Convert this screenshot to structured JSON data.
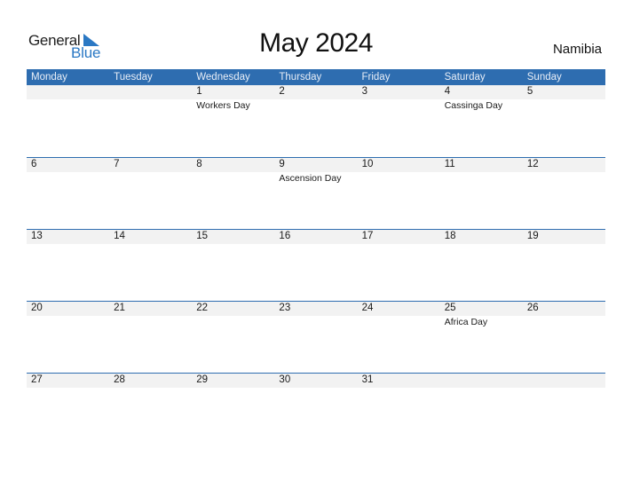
{
  "logo": {
    "word1": "General",
    "word2": "Blue",
    "icon": "triangle-flag-icon"
  },
  "title": "May 2024",
  "country": "Namibia",
  "colors": {
    "accent": "#2e6db0",
    "date_strip": "#f2f2f2",
    "logo_blue": "#2a78c4"
  },
  "weekdays": [
    "Monday",
    "Tuesday",
    "Wednesday",
    "Thursday",
    "Friday",
    "Saturday",
    "Sunday"
  ],
  "weeks": [
    {
      "days": [
        {
          "num": "",
          "holiday": ""
        },
        {
          "num": "",
          "holiday": ""
        },
        {
          "num": "1",
          "holiday": "Workers Day"
        },
        {
          "num": "2",
          "holiday": ""
        },
        {
          "num": "3",
          "holiday": ""
        },
        {
          "num": "4",
          "holiday": "Cassinga Day"
        },
        {
          "num": "5",
          "holiday": ""
        }
      ]
    },
    {
      "days": [
        {
          "num": "6",
          "holiday": ""
        },
        {
          "num": "7",
          "holiday": ""
        },
        {
          "num": "8",
          "holiday": ""
        },
        {
          "num": "9",
          "holiday": "Ascension Day"
        },
        {
          "num": "10",
          "holiday": ""
        },
        {
          "num": "11",
          "holiday": ""
        },
        {
          "num": "12",
          "holiday": ""
        }
      ]
    },
    {
      "days": [
        {
          "num": "13",
          "holiday": ""
        },
        {
          "num": "14",
          "holiday": ""
        },
        {
          "num": "15",
          "holiday": ""
        },
        {
          "num": "16",
          "holiday": ""
        },
        {
          "num": "17",
          "holiday": ""
        },
        {
          "num": "18",
          "holiday": ""
        },
        {
          "num": "19",
          "holiday": ""
        }
      ]
    },
    {
      "days": [
        {
          "num": "20",
          "holiday": ""
        },
        {
          "num": "21",
          "holiday": ""
        },
        {
          "num": "22",
          "holiday": ""
        },
        {
          "num": "23",
          "holiday": ""
        },
        {
          "num": "24",
          "holiday": ""
        },
        {
          "num": "25",
          "holiday": "Africa Day"
        },
        {
          "num": "26",
          "holiday": ""
        }
      ]
    },
    {
      "days": [
        {
          "num": "27",
          "holiday": ""
        },
        {
          "num": "28",
          "holiday": ""
        },
        {
          "num": "29",
          "holiday": ""
        },
        {
          "num": "30",
          "holiday": ""
        },
        {
          "num": "31",
          "holiday": ""
        },
        {
          "num": "",
          "holiday": ""
        },
        {
          "num": "",
          "holiday": ""
        }
      ]
    }
  ]
}
